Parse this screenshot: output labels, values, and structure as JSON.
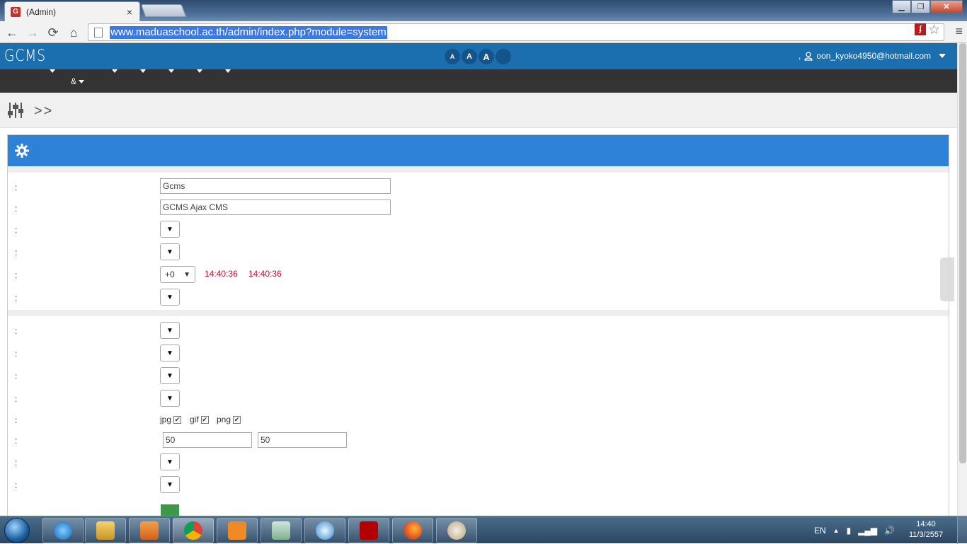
{
  "browser": {
    "tab_title": "(Admin)",
    "tab_favicon": "G",
    "tab_close": "×",
    "url": "www.maduaschool.ac.th/admin/index.php?module=system",
    "window_buttons": {
      "minimize": "▁",
      "maximize": "❐",
      "close": "✕"
    },
    "nav": {
      "back": "←",
      "forward": "→",
      "reload": "⟳",
      "home": "⌂"
    },
    "menu_glyph": "≡",
    "star_glyph": "☆"
  },
  "header": {
    "logo": "GCMS",
    "font_sizes": [
      "A",
      "A",
      "A",
      ""
    ],
    "user_prefix": ",",
    "user_email": "oon_kyoko4950@hotmail.com"
  },
  "menubar": {
    "items": [
      {
        "label": ""
      },
      {
        "label": "&"
      },
      {
        "label": ""
      },
      {
        "label": ""
      },
      {
        "label": ""
      },
      {
        "label": ""
      },
      {
        "label": ""
      }
    ]
  },
  "breadcrumb": {
    "separator": ">>"
  },
  "form": {
    "colon": ":",
    "web_title": "Gcms",
    "web_description": "GCMS Ajax CMS",
    "timezone": "+0",
    "time_server": "14:40:36",
    "time_local": "14:40:36",
    "image_types": [
      {
        "label": "jpg",
        "checked": true
      },
      {
        "label": "gif",
        "checked": true
      },
      {
        "label": "png",
        "checked": true
      }
    ],
    "thumb_width": "50",
    "thumb_height": "50",
    "select_arrow": "▼"
  },
  "taskbar": {
    "lang": "EN",
    "time": "14:40",
    "date": "11/3/2557"
  },
  "colors": {
    "header_blue": "#1c6fae",
    "panel_blue": "#2d81d6",
    "menubar": "#333333",
    "time_red": "#c8102e",
    "submit_green": "#3a9a4a"
  }
}
